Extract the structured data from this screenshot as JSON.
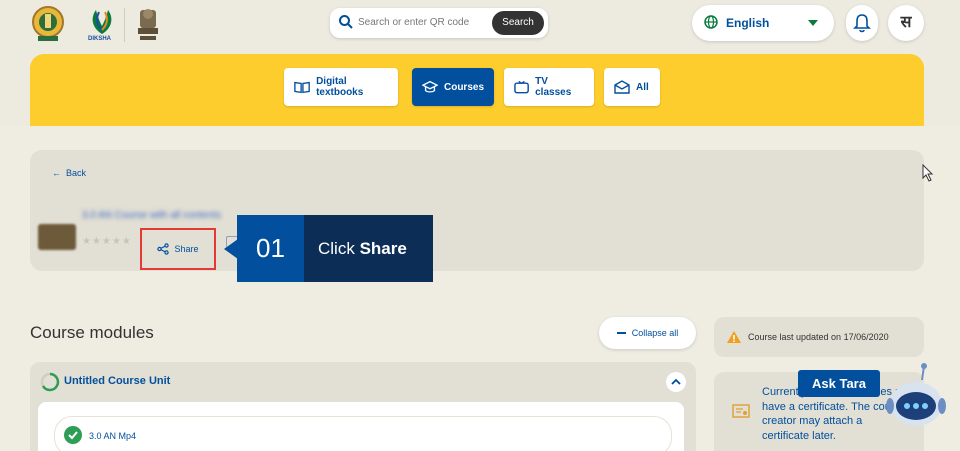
{
  "header": {
    "logo_label": "DIKSHA",
    "search": {
      "placeholder": "Search or enter QR code",
      "button_label": "Search"
    },
    "language": {
      "selected": "English"
    },
    "avatar_initial": "स"
  },
  "nav_tabs": [
    {
      "label": "Digital textbooks",
      "active": false,
      "icon": "book-icon"
    },
    {
      "label": "Courses",
      "active": true,
      "icon": "graduation-cap-icon"
    },
    {
      "label": "TV classes",
      "active": false,
      "icon": "tv-icon"
    },
    {
      "label": "All",
      "active": false,
      "icon": "inbox-icon"
    }
  ],
  "course_header": {
    "back_label": "Back",
    "title": "3.0 AN Course with all contents",
    "share_label": "Share"
  },
  "callout": {
    "number": "01",
    "prefix": "Click ",
    "emphasis": "Share"
  },
  "modules": {
    "title": "Course modules",
    "collapse_label": "Collapse all",
    "unit_title": "Untitled Course Unit",
    "items": [
      {
        "label": "3.0 AN Mp4",
        "status": "completed"
      }
    ]
  },
  "sidebar": {
    "last_updated": "Course last updated on 17/06/2020",
    "certificate_text": "Currently, this course does not have a certificate. The course creator may attach a certificate later."
  },
  "assistant": {
    "label": "Ask Tara"
  },
  "colors": {
    "brand_blue": "#024f9d",
    "accent_yellow": "#fdcd2d",
    "highlight_red": "#e53935",
    "callout_dark": "#0c2d55"
  }
}
